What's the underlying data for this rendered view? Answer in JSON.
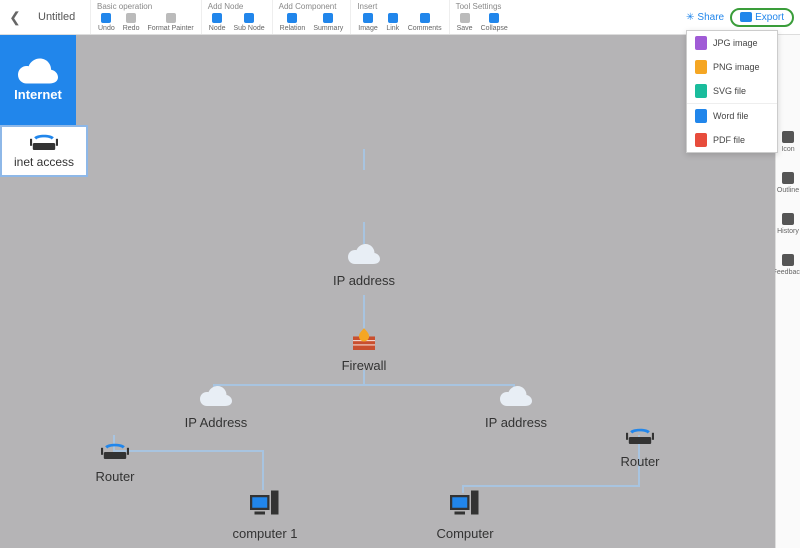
{
  "header": {
    "title": "Untitled",
    "groups": [
      {
        "label": "Basic operation",
        "items": [
          {
            "name": "undo",
            "label": "Undo",
            "color": "#2186eb"
          },
          {
            "name": "redo",
            "label": "Redo",
            "color": "#bbb"
          },
          {
            "name": "format-painter",
            "label": "Format Painter",
            "color": "#bbb"
          }
        ]
      },
      {
        "label": "Add Node",
        "items": [
          {
            "name": "node",
            "label": "Node",
            "color": "#2186eb"
          },
          {
            "name": "subnode",
            "label": "Sub Node",
            "color": "#2186eb"
          }
        ]
      },
      {
        "label": "Add Component",
        "items": [
          {
            "name": "relation",
            "label": "Relation",
            "color": "#2186eb"
          },
          {
            "name": "summary",
            "label": "Summary",
            "color": "#2186eb"
          }
        ]
      },
      {
        "label": "Insert",
        "items": [
          {
            "name": "image",
            "label": "Image",
            "color": "#2186eb"
          },
          {
            "name": "link",
            "label": "Link",
            "color": "#2186eb"
          },
          {
            "name": "comments",
            "label": "Comments",
            "color": "#2186eb"
          }
        ]
      },
      {
        "label": "Tool Settings",
        "items": [
          {
            "name": "save",
            "label": "Save",
            "color": "#bbb"
          },
          {
            "name": "collapse",
            "label": "Collapse",
            "color": "#2186eb"
          }
        ]
      }
    ],
    "share_label": "Share",
    "export_label": "Export"
  },
  "export_menu": [
    {
      "icon_color": "#a05bd6",
      "label": "JPG image"
    },
    {
      "icon_color": "#f5a623",
      "label": "PNG image"
    },
    {
      "icon_color": "#1abc9c",
      "label": "SVG file"
    },
    {
      "icon_color": "#2186eb",
      "label": "Word file",
      "divider": true
    },
    {
      "icon_color": "#e74c3c",
      "label": "PDF file"
    }
  ],
  "side": [
    {
      "name": "icon",
      "label": "Icon"
    },
    {
      "name": "outline",
      "label": "Outline"
    },
    {
      "name": "history",
      "label": "History"
    },
    {
      "name": "feedback",
      "label": "Feedback"
    }
  ],
  "diagram": {
    "internet": "Internet",
    "inet_access": "inet access",
    "ip1": "IP address",
    "firewall": "Firewall",
    "ip_left": "IP Address",
    "ip_right": "IP address",
    "router_left": "Router",
    "router_right": "Router",
    "computer_left": "computer 1",
    "computer_right": "Computer"
  }
}
